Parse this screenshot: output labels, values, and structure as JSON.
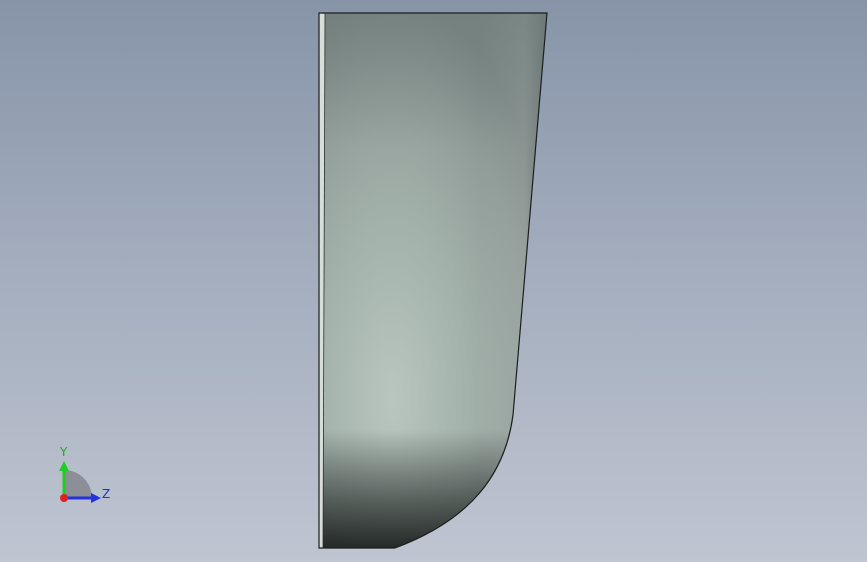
{
  "viewport": {
    "background_top": "#8794a8",
    "background_bottom": "#bfc5d1"
  },
  "part": {
    "face_color": "#a9b7b0",
    "edge_color": "#1a1f1c"
  },
  "triad": {
    "labels": {
      "y": "Y",
      "z": "Z"
    },
    "colors": {
      "y_axis": "#22cc22",
      "z_axis": "#2233dd",
      "x_axis": "#dd2222"
    }
  }
}
